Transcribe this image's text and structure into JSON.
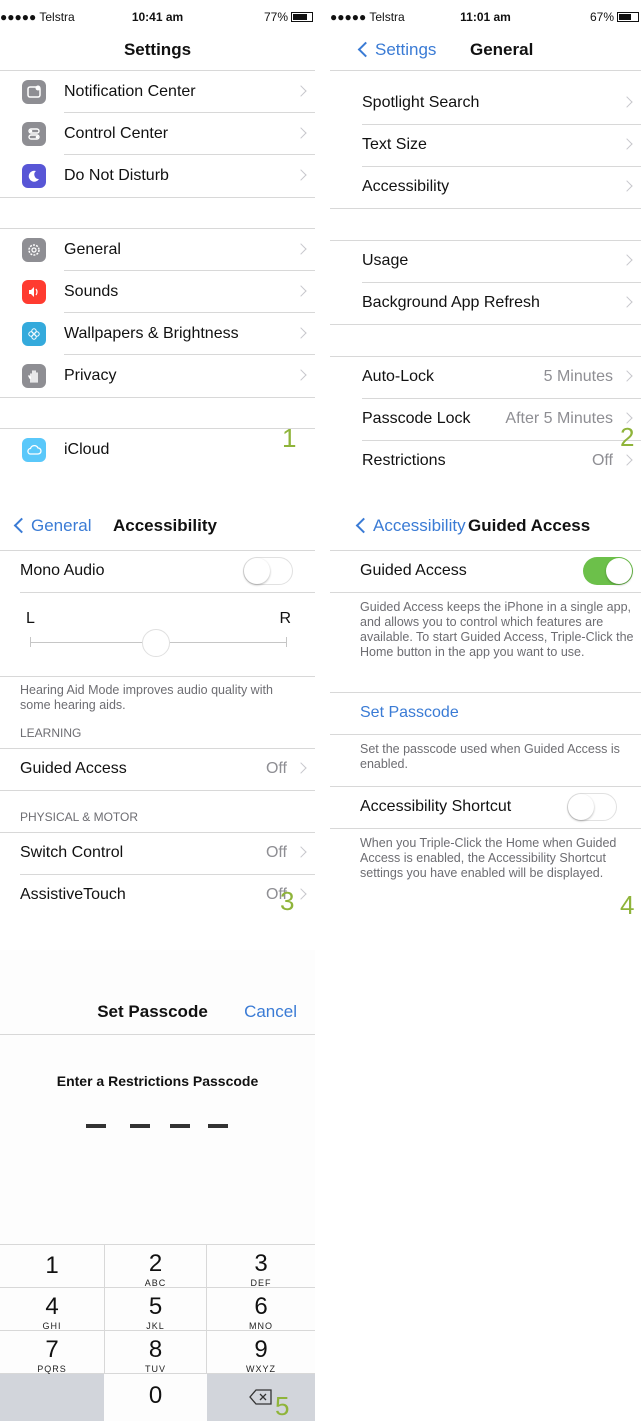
{
  "panel1": {
    "status": {
      "carrier": "●●●●● Telstra",
      "time": "10:41 am",
      "battery": "77%",
      "battery_level": 0.77
    },
    "title": "Settings",
    "group1": [
      {
        "label": "Notification Center",
        "icon": "notification-center-icon",
        "color": "#8e8e93"
      },
      {
        "label": "Control Center",
        "icon": "control-center-icon",
        "color": "#8e8e93"
      },
      {
        "label": "Do Not Disturb",
        "icon": "moon-icon",
        "color": "#5856d6"
      }
    ],
    "group2": [
      {
        "label": "General",
        "icon": "gear-icon",
        "color": "#8e8e93"
      },
      {
        "label": "Sounds",
        "icon": "speaker-icon",
        "color": "#ff3b30"
      },
      {
        "label": "Wallpapers & Brightness",
        "icon": "flower-icon",
        "color": "#34aadc"
      },
      {
        "label": "Privacy",
        "icon": "hand-icon",
        "color": "#8e8e93"
      }
    ],
    "group3": [
      {
        "label": "iCloud",
        "icon": "cloud-icon",
        "color": "#5ac8fa"
      }
    ],
    "step": "1"
  },
  "panel2": {
    "status": {
      "carrier": "●●●●● Telstra",
      "time": "11:01 am",
      "battery": "67%",
      "battery_level": 0.67
    },
    "back": "Settings",
    "title": "General",
    "group1": [
      {
        "label": "Spotlight Search",
        "value": ""
      },
      {
        "label": "Text Size",
        "value": ""
      },
      {
        "label": "Accessibility",
        "value": ""
      }
    ],
    "group2": [
      {
        "label": "Usage",
        "value": ""
      },
      {
        "label": "Background App Refresh",
        "value": ""
      }
    ],
    "group3": [
      {
        "label": "Auto-Lock",
        "value": "5 Minutes"
      },
      {
        "label": "Passcode Lock",
        "value": "After 5 Minutes"
      },
      {
        "label": "Restrictions",
        "value": "Off"
      }
    ],
    "step": "2"
  },
  "panel3": {
    "back": "General",
    "title": "Accessibility",
    "mono_audio": {
      "label": "Mono Audio",
      "on": false
    },
    "balance": {
      "left": "L",
      "right": "R",
      "value": 0.5
    },
    "hearing_footer": "Hearing Aid Mode improves audio quality with some hearing aids.",
    "learning_header": "LEARNING",
    "guided_access": {
      "label": "Guided Access",
      "value": "Off"
    },
    "physical_header": "PHYSICAL & MOTOR",
    "switch_control": {
      "label": "Switch Control",
      "value": "Off"
    },
    "assistive_touch": {
      "label": "AssistiveTouch",
      "value": "Off"
    },
    "step": "3"
  },
  "panel4": {
    "back": "Accessibility",
    "title": "Guided Access",
    "guided_access": {
      "label": "Guided Access",
      "on": true
    },
    "guided_footer": "Guided Access keeps the iPhone in a single app, and allows you to control which features are available. To start Guided Access, Triple-Click the Home button in the app you want to use.",
    "set_passcode": "Set Passcode",
    "passcode_footer": "Set the passcode used when Guided Access is enabled.",
    "shortcut": {
      "label": "Accessibility Shortcut",
      "on": false
    },
    "shortcut_footer": "When you Triple-Click the Home when Guided Access is enabled, the Accessibility Shortcut settings you have enabled will be displayed.",
    "step": "4"
  },
  "panel5": {
    "title": "Set Passcode",
    "cancel": "Cancel",
    "prompt": "Enter a Restrictions Passcode",
    "keys": [
      {
        "digit": "1",
        "letters": ""
      },
      {
        "digit": "2",
        "letters": "ABC"
      },
      {
        "digit": "3",
        "letters": "DEF"
      },
      {
        "digit": "4",
        "letters": "GHI"
      },
      {
        "digit": "5",
        "letters": "JKL"
      },
      {
        "digit": "6",
        "letters": "MNO"
      },
      {
        "digit": "7",
        "letters": "PQRS"
      },
      {
        "digit": "8",
        "letters": "TUV"
      },
      {
        "digit": "9",
        "letters": "WXYZ"
      },
      {
        "digit": "0",
        "letters": ""
      }
    ],
    "delete_icon": "backspace-icon",
    "key_gray": "#d2d5db",
    "step": "5"
  },
  "colors": {
    "accent": "#3a7bd5",
    "toggle_on": "#6cc04a",
    "step_number": "#8fb43a"
  }
}
